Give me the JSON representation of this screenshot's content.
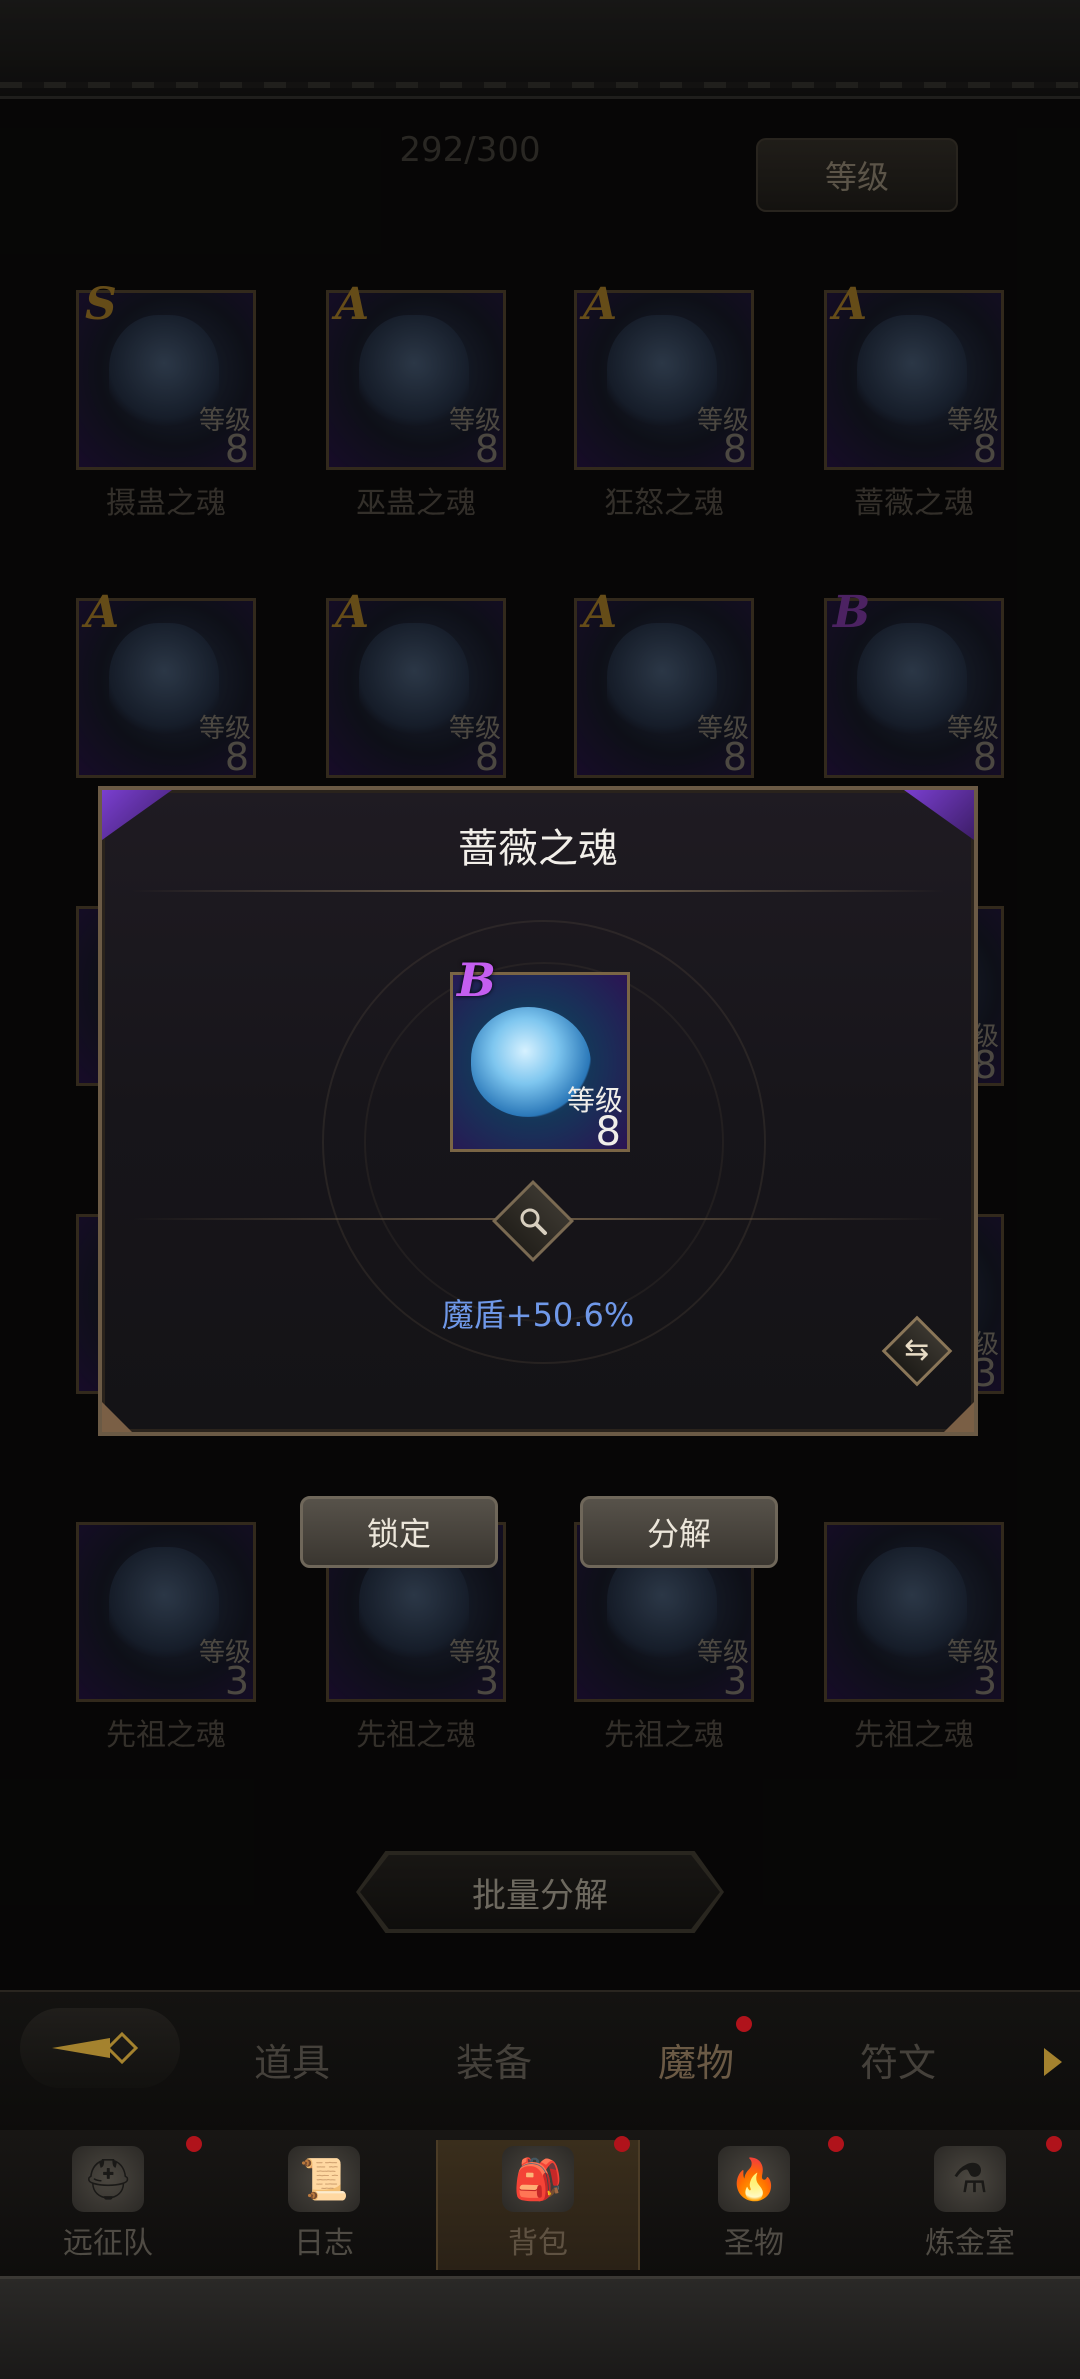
{
  "header": {
    "capacity": "292/300",
    "sort_label": "等级"
  },
  "grid": {
    "row1": [
      {
        "rank": "S",
        "level_label": "等级",
        "level": "8",
        "name": "摄蛊之魂"
      },
      {
        "rank": "A",
        "level_label": "等级",
        "level": "8",
        "name": "巫蛊之魂"
      },
      {
        "rank": "A",
        "level_label": "等级",
        "level": "8",
        "name": "狂怒之魂"
      },
      {
        "rank": "A",
        "level_label": "等级",
        "level": "8",
        "name": "蔷薇之魂"
      }
    ],
    "row2": [
      {
        "rank": "A",
        "level_label": "等级",
        "level": "8"
      },
      {
        "rank": "A",
        "level_label": "等级",
        "level": "8"
      },
      {
        "rank": "A",
        "level_label": "等级",
        "level": "8"
      },
      {
        "rank": "B",
        "level_label": "等级",
        "level": "8"
      }
    ],
    "row5": [
      {
        "level_label": "等级",
        "level": "3",
        "name": "先祖之魂"
      },
      {
        "level_label": "等级",
        "level": "3",
        "name": "先祖之魂"
      },
      {
        "level_label": "等级",
        "level": "3",
        "name": "先祖之魂"
      },
      {
        "level_label": "等级",
        "level": "3",
        "name": "先祖之魂"
      }
    ],
    "partial_right": [
      {
        "level_label": "级",
        "level": "8"
      },
      {
        "level_label": "级",
        "level": "3"
      }
    ]
  },
  "popup": {
    "title": "蔷薇之魂",
    "item": {
      "rank": "B",
      "level_label": "等级",
      "level": "8"
    },
    "stat": "魔盾+50.6%"
  },
  "actions": {
    "lock_label": "锁定",
    "decompose_label": "分解",
    "batch_label": "批量分解"
  },
  "category_tabs": [
    "道具",
    "装备",
    "魔物",
    "符文"
  ],
  "active_category": "魔物",
  "bottom_nav": [
    {
      "label": "远征队"
    },
    {
      "label": "日志"
    },
    {
      "label": "背包"
    },
    {
      "label": "圣物"
    },
    {
      "label": "炼金室"
    }
  ],
  "colors": {
    "accent_purple": "#7a3fd0",
    "stat_blue": "#6f98e8",
    "badge_red": "#b0131b"
  }
}
